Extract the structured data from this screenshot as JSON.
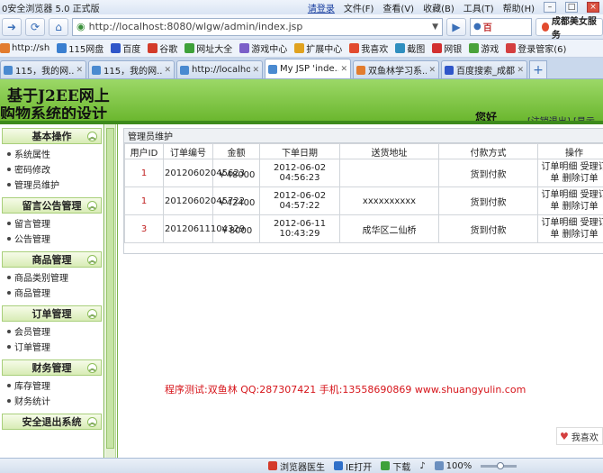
{
  "browser": {
    "app_title": "0安全浏览器 5.0 正式版",
    "login_label": "请登录",
    "menus": [
      "文件(F)",
      "查看(V)",
      "收藏(B)",
      "工具(T)",
      "帮助(H)"
    ],
    "address": "http://localhost:8080/wlgw/admin/index.jsp",
    "search_text": "成都美女服务",
    "bookmarks": [
      "http://sh",
      "115网盘",
      "百度",
      "谷歌",
      "网址大全",
      "游戏中心",
      "扩展中心",
      "我喜欢",
      "截图",
      "网银",
      "游戏",
      "登录管家(6)"
    ],
    "tabs": [
      {
        "label": "115，我的网..."
      },
      {
        "label": "115，我的网..."
      },
      {
        "label": "http://localho..."
      },
      {
        "label": "My JSP 'inde..."
      },
      {
        "label": "双鱼林学习系..."
      },
      {
        "label": "百度搜索_成都..."
      }
    ],
    "status": {
      "doctor": "浏览器医生",
      "ie_open": "IE打开",
      "download": "下载",
      "zoom": "100%"
    },
    "like_box": "我喜欢"
  },
  "page": {
    "banner_line1": "基于J2EE网上",
    "banner_line2": "购物系统的设计",
    "greeting": "您好",
    "greeting_tail": "[注销退出] [显示主页]",
    "sidebar": [
      {
        "title": "基本操作",
        "items": [
          "系统属性",
          "密码修改",
          "管理员维护"
        ]
      },
      {
        "title": "留言公告管理",
        "items": [
          "留言管理",
          "公告管理"
        ]
      },
      {
        "title": "商品管理",
        "items": [
          "商品类别管理",
          "商品管理"
        ]
      },
      {
        "title": "订单管理",
        "items": [
          "会员管理",
          "订单管理"
        ]
      },
      {
        "title": "财务管理",
        "items": [
          "库存管理",
          "财务统计"
        ]
      },
      {
        "title": "安全退出系统",
        "items": []
      }
    ],
    "panel_title": "管理员维护",
    "table": {
      "headers": [
        "用户ID",
        "订单编号",
        "金额",
        "下单日期",
        "送货地址",
        "付款方式",
        "操作"
      ],
      "rows": [
        {
          "uid": "1",
          "order": "20120602045623",
          "amount": "￥48000",
          "date": "2012-06-02 04:56:23",
          "address": "",
          "pay": "货到付款",
          "ops": "订单明细 受理订单 删除订单"
        },
        {
          "uid": "1",
          "order": "20120602045722",
          "amount": "￥42400",
          "date": "2012-06-02 04:57:22",
          "address": "xxxxxxxxxx",
          "pay": "货到付款",
          "ops": "订单明细 受理订单 删除订单"
        },
        {
          "uid": "3",
          "order": "20120611104329",
          "amount": "￥8000",
          "date": "2012-06-11 10:43:29",
          "address": "成华区二仙桥",
          "pay": "货到付款",
          "ops": "订单明细 受理订单 删除订单"
        }
      ]
    },
    "footer_info": "程序测试:双鱼林 QQ:287307421 手机:13558690869 www.shuangyulin.com"
  }
}
